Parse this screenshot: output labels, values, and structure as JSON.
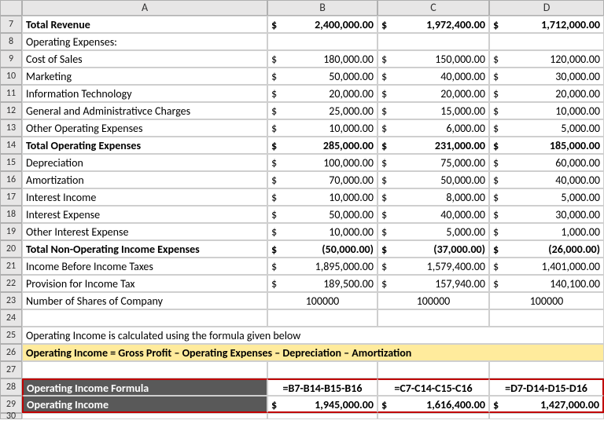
{
  "columns": [
    "A",
    "B",
    "C",
    "D"
  ],
  "rows": [
    {
      "n": 7,
      "label": "Total Revenue",
      "bold": true,
      "vals": [
        "2,400,000.00",
        "1,972,400.00",
        "1,712,000.00"
      ],
      "money": true
    },
    {
      "n": 8,
      "label": "Operating Expenses:",
      "bold": false,
      "vals": [
        "",
        "",
        ""
      ],
      "money": false
    },
    {
      "n": 9,
      "label": "Cost of Sales",
      "vals": [
        "180,000.00",
        "150,000.00",
        "120,000.00"
      ],
      "money": true
    },
    {
      "n": 10,
      "label": "Marketing",
      "vals": [
        "50,000.00",
        "40,000.00",
        "30,000.00"
      ],
      "money": true
    },
    {
      "n": 11,
      "label": "Information Technology",
      "vals": [
        "20,000.00",
        "20,000.00",
        "20,000.00"
      ],
      "money": true
    },
    {
      "n": 12,
      "label": "General and Administrativce Charges",
      "vals": [
        "25,000.00",
        "15,000.00",
        "10,000.00"
      ],
      "money": true
    },
    {
      "n": 13,
      "label": "Other Operating Expenses",
      "vals": [
        "10,000.00",
        "6,000.00",
        "5,000.00"
      ],
      "money": true
    },
    {
      "n": 14,
      "label": "Total Operating Expenses",
      "bold": true,
      "vals": [
        "285,000.00",
        "231,000.00",
        "185,000.00"
      ],
      "money": true
    },
    {
      "n": 15,
      "label": "Depreciation",
      "vals": [
        "100,000.00",
        "75,000.00",
        "60,000.00"
      ],
      "money": true
    },
    {
      "n": 16,
      "label": "Amortization",
      "vals": [
        "70,000.00",
        "50,000.00",
        "40,000.00"
      ],
      "money": true
    },
    {
      "n": 17,
      "label": "Interest Income",
      "vals": [
        "10,000.00",
        "8,000.00",
        "5,000.00"
      ],
      "money": true
    },
    {
      "n": 18,
      "label": "Interest Expense",
      "vals": [
        "50,000.00",
        "40,000.00",
        "30,000.00"
      ],
      "money": true
    },
    {
      "n": 19,
      "label": "Other Interest Expense",
      "vals": [
        "10,000.00",
        "5,000.00",
        "1,000.00"
      ],
      "money": true
    },
    {
      "n": 20,
      "label": "Total Non-Operating Income Expenses",
      "bold": true,
      "vals": [
        "(50,000.00)",
        "(37,000.00)",
        "(26,000.00)"
      ],
      "money": true
    },
    {
      "n": 21,
      "label": "Income Before Income Taxes",
      "vals": [
        "1,895,000.00",
        "1,579,400.00",
        "1,401,000.00"
      ],
      "money": true
    },
    {
      "n": 22,
      "label": "Provision for Income Tax",
      "vals": [
        "189,500.00",
        "157,940.00",
        "140,100.00"
      ],
      "money": true
    },
    {
      "n": 23,
      "label": "Number of Shares of Company",
      "vals": [
        "100000",
        "100000",
        "100000"
      ],
      "money": false,
      "center": true
    }
  ],
  "note_row": 25,
  "note": "Operating Income is calculated using the formula given below",
  "formula_def_row": 26,
  "formula_def": "Operating Income = Gross Profit – Operating Expenses – Depreciation – Amortization",
  "formula_row": {
    "n": 28,
    "label": "Operating Income Formula",
    "vals": [
      "=B7-B14-B15-B16",
      "=C7-C14-C15-C16",
      "=D7-D14-D15-D16"
    ]
  },
  "income_row": {
    "n": 29,
    "label": "Operating Income",
    "vals": [
      "1,945,000.00",
      "1,616,400.00",
      "1,427,000.00"
    ]
  },
  "last_row": 30,
  "currency": "$"
}
